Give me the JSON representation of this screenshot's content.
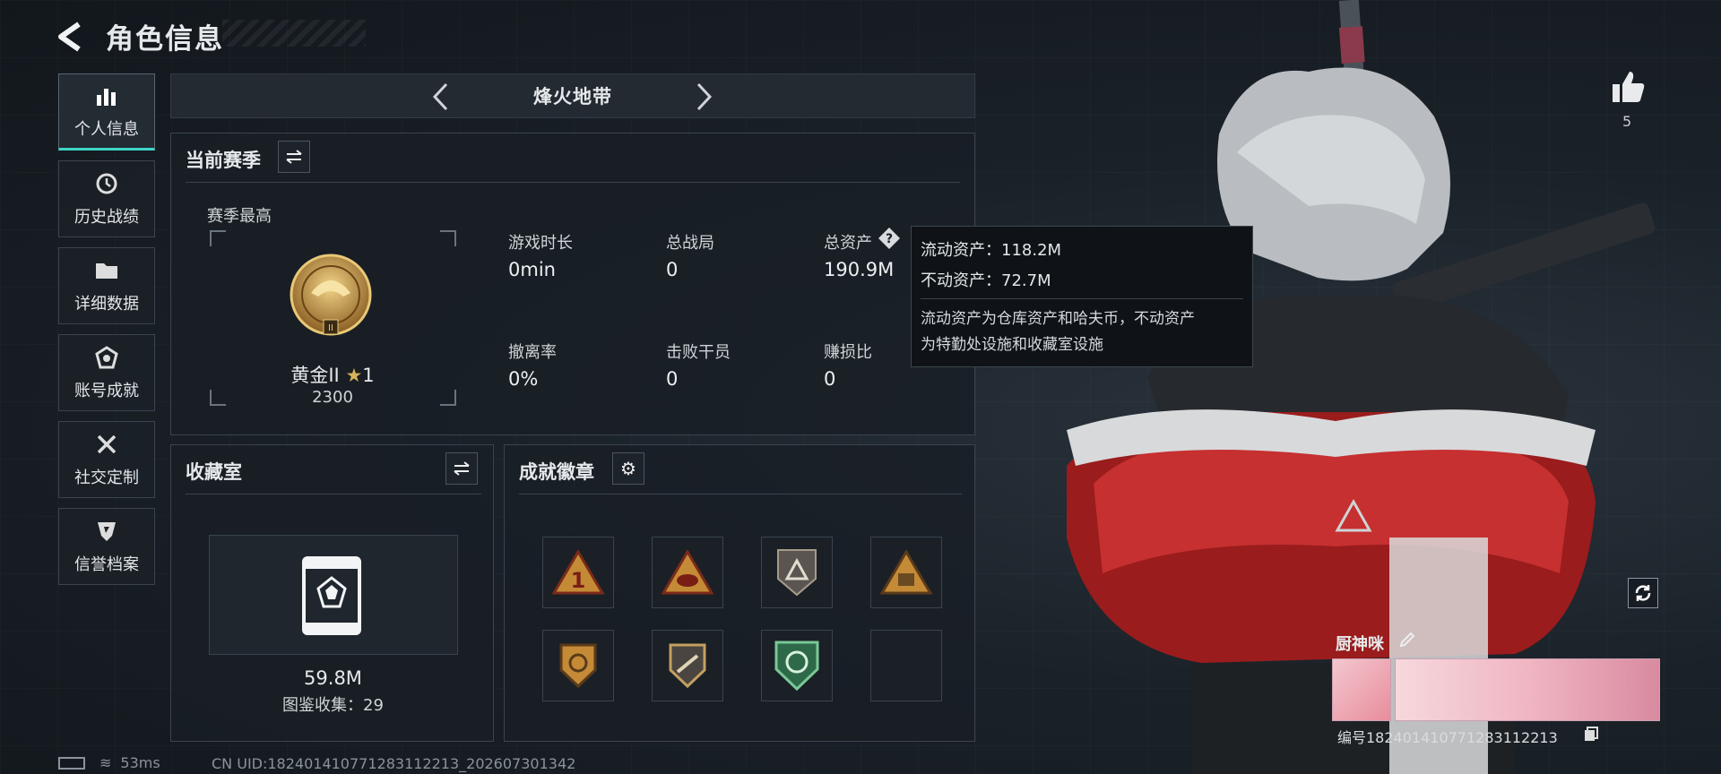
{
  "header": {
    "title": "角色信息"
  },
  "sidebar": {
    "items": [
      {
        "label": "个人信息",
        "icon": "bar-chart-icon",
        "active": true
      },
      {
        "label": "历史战绩",
        "icon": "history-clock-icon",
        "active": false
      },
      {
        "label": "详细数据",
        "icon": "folder-icon",
        "active": false
      },
      {
        "label": "账号成就",
        "icon": "achievement-icon",
        "active": false
      },
      {
        "label": "社交定制",
        "icon": "tools-icon",
        "active": false
      },
      {
        "label": "信誉档案",
        "icon": "reputation-shield-icon",
        "active": false
      }
    ]
  },
  "map": {
    "name": "烽火地带"
  },
  "season": {
    "title": "当前赛季",
    "best_label": "赛季最高",
    "rank_name": "黄金II",
    "rank_stars": "1",
    "rank_points": "2300",
    "stats": [
      {
        "label": "游戏时长",
        "value": "0min"
      },
      {
        "label": "总战局",
        "value": "0"
      },
      {
        "label": "总资产",
        "value": "190.9M"
      },
      {
        "label": "撤离率",
        "value": "0%"
      },
      {
        "label": "击败干员",
        "value": "0"
      },
      {
        "label": "赚损比",
        "value": "0"
      }
    ]
  },
  "tooltip": {
    "liquid": "流动资产：118.2M",
    "fixed": "不动资产：72.7M",
    "desc_line1": "流动资产为仓库资产和哈夫币，不动资产",
    "desc_line2": "为特勤处设施和收藏室设施"
  },
  "collection": {
    "title": "收藏室",
    "value": "59.8M",
    "catalog": "图鉴收集：29"
  },
  "achievements": {
    "title": "成就徽章",
    "badges": [
      "badge-1-icon",
      "badge-2-icon",
      "badge-3-icon",
      "badge-4-icon",
      "badge-5-icon",
      "badge-6-icon",
      "badge-7-icon",
      "empty"
    ]
  },
  "profile": {
    "likes": "5",
    "nickname": "厨神咪",
    "serial": "编号1824014107712831122​13"
  },
  "status": {
    "ping": "53ms",
    "uid": "CN UID:182401410771283112213_202607301342"
  },
  "colors": {
    "accent": "#3fd4c8",
    "gold": "#c9a24a"
  }
}
